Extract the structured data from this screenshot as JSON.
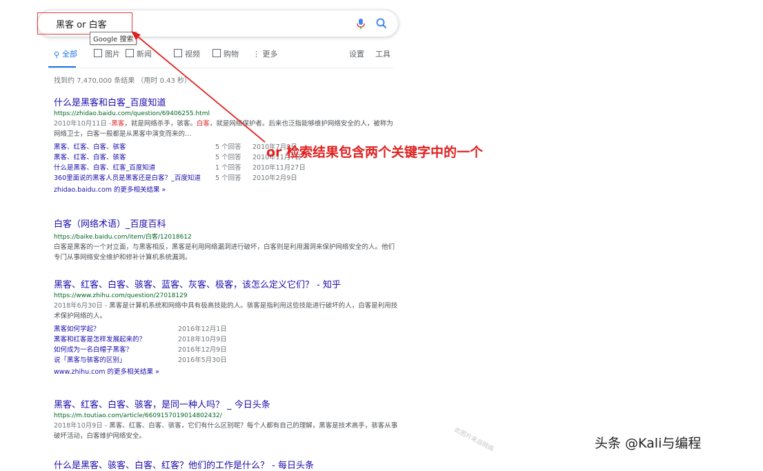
{
  "search": {
    "query": "黑客 or 白客",
    "tooltip": "Google 搜索",
    "mic_icon": "mic-icon",
    "search_icon": "search-icon"
  },
  "tabs": {
    "items": [
      {
        "label": "全部",
        "icon": "search-icon"
      },
      {
        "label": "图片",
        "icon": "image-icon"
      },
      {
        "label": "新闻",
        "icon": "news-icon"
      },
      {
        "label": "视频",
        "icon": "video-icon"
      },
      {
        "label": "购物",
        "icon": "tag-icon"
      },
      {
        "label": "更多",
        "icon": "more-icon"
      }
    ],
    "settings": "设置",
    "tools": "工具"
  },
  "stats": "找到约 7,470,000 条结果 （用时 0.43 秒）",
  "results": [
    {
      "title": "什么是黑客和白客_百度知道",
      "url": "https://zhidao.baidu.com/question/69406255.html",
      "snippet": {
        "date": "2010年10月11日 -",
        "text_a": " 黑客 ",
        "a": "黑客",
        "text_b": "，就是网络杀手，骇客。",
        "b": "白客",
        "text_c": "，就是网络保护者。后来也泛指能够维护网络安全的人，被称为网络卫士，白客一般都是从黑客中演变而来的…"
      },
      "subrows": [
        {
          "title": "黑客、红客、白客、骇客",
          "count": "5 个回答",
          "date": "2010年7月9日"
        },
        {
          "title": "黑客、红客、白客、骇客",
          "count": "5 个回答",
          "date": "2010年11月7日"
        },
        {
          "title": "什么是黑客、白客、红客_百度知道",
          "count": "1 个回答",
          "date": "2010年11月27日"
        },
        {
          "title": "360里面说的黑客人员是黑客还是白客？_百度知道",
          "count": "5 个回答",
          "date": "2010年2月9日"
        }
      ],
      "more": "zhidao.baidu.com 的更多相关结果 »"
    },
    {
      "title": "白客（网络术语）_百度百科",
      "url": "https://baike.baidu.com/item/白客/12018612",
      "snippet": {
        "text": "白客是黑客的一个对立面，与黑客相反，黑客是利用网络漏洞进行破坏，白客则是利用漏洞来保护网络安全的人。他们专门从事网络安全维护和修补计算机系统漏洞。"
      }
    },
    {
      "title": "黑客、红客、白客、骇客、蓝客、灰客、极客，该怎么定义它们？ - 知乎",
      "url": "https://www.zhihu.com/question/27018129",
      "snippet": {
        "date": "2018年6月30日 -",
        "text": " 黑客是计算机系统和网络中具有极高技能的人。骇客是指利用这些技能进行破坏的人，白客是利用技术保护网络的人。"
      },
      "subrows": [
        {
          "title": "黑客如何学起？",
          "date": "2016年12月1日"
        },
        {
          "title": "黑客和红客是怎样发展起来的？",
          "date": "2018年10月9日"
        },
        {
          "title": "如何成为一名白帽子黑客？",
          "date": "2016年12月9日"
        },
        {
          "title": "说「黑客与骇客的区别」",
          "date": "2016年5月30日"
        }
      ],
      "more": "www.zhihu.com 的更多相关结果 »"
    },
    {
      "title": "黑客、红客、白客、骇客，是同一种人吗？ _ 今日头条",
      "url": "https://m.toutiao.com/article/6609157019014802432/",
      "snippet": {
        "date": "2018年10月9日 -",
        "text": " 黑客、红客、白客、骇客，它们有什么区别呢？每个人都有自己的理解，黑客是技术高手，骇客从事破坏活动，白客维护网络安全。"
      }
    },
    {
      "title": "什么是黑客、骇客、白客、红客？他们的工作是什么？ - 每日头条",
      "url": "",
      "snippet": {}
    }
  ],
  "annotation": "or 检索结果包含两个关键字中的一个",
  "watermark": "头条 @Kali与编程",
  "stamp": "此图片来自网络",
  "colors": {
    "accent": "#1a73e8",
    "link": "#1a0dab",
    "url": "#006621",
    "highlight": "#dd2b2b",
    "annotation": "#e02020"
  }
}
